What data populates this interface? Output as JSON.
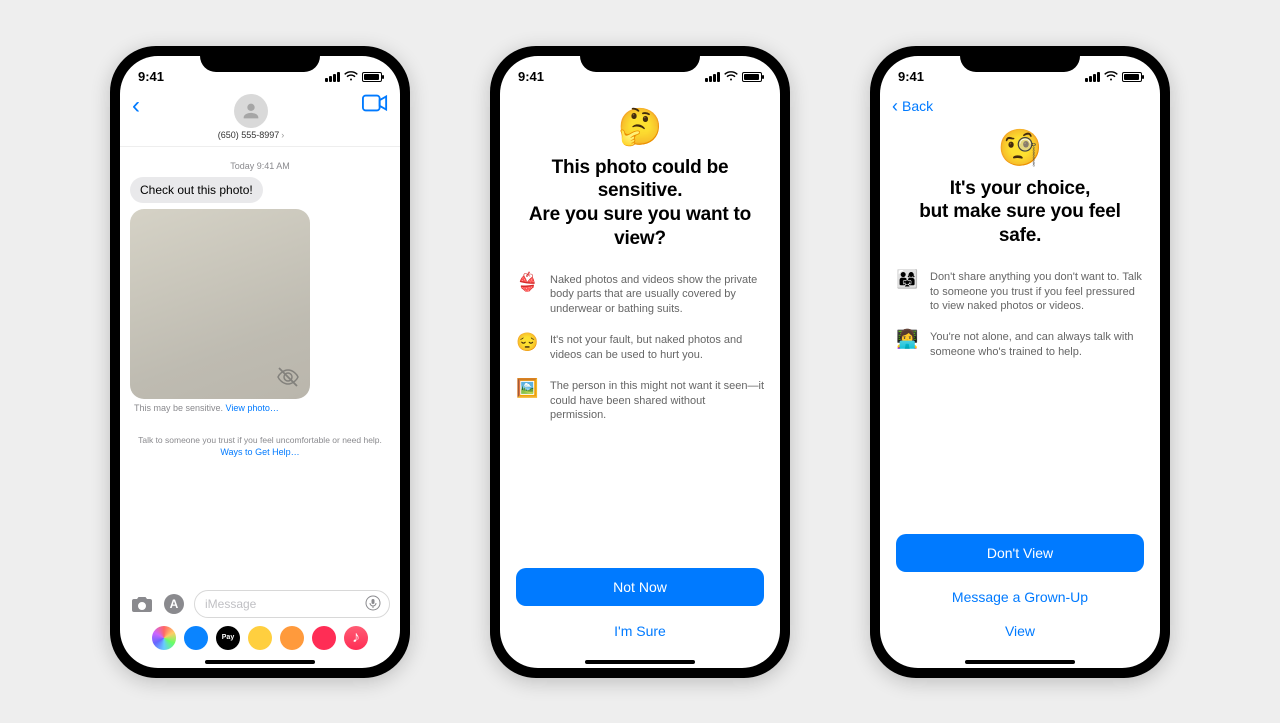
{
  "status_time": "9:41",
  "phone1": {
    "contact_number": "(650) 555-8997",
    "timestamp": "Today 9:41 AM",
    "message_text": "Check out this photo!",
    "caption_prefix": "This may be sensitive.  ",
    "caption_link": "View photo…",
    "help_line1": "Talk to someone you trust if you feel uncomfortable or need help.",
    "help_line2": "Ways to Get Help…",
    "input_placeholder": "iMessage"
  },
  "phone2": {
    "emoji": "🤔",
    "title_line1": "This photo could be sensitive.",
    "title_line2": "Are you sure you want to view?",
    "rows": [
      {
        "icon": "👙",
        "text": "Naked photos and videos show the private body parts that are usually covered by underwear or bathing suits."
      },
      {
        "icon": "😔",
        "text": "It's not your fault, but naked photos and videos can be used to hurt you."
      },
      {
        "icon": "🖼️",
        "text": "The person in this might not want it seen—it could have been shared without permission."
      }
    ],
    "primary_button": "Not Now",
    "secondary_button": "I'm Sure"
  },
  "phone3": {
    "back_label": "Back",
    "emoji": "🧐",
    "title_line1": "It's your choice,",
    "title_line2": "but make sure you feel safe.",
    "rows": [
      {
        "icon": "👨‍👩‍👧",
        "text": "Don't share anything you don't want to. Talk to someone you trust if you feel pressured to view naked photos or videos."
      },
      {
        "icon": "👩‍💻",
        "text": "You're not alone, and can always talk with someone who's trained to help."
      }
    ],
    "primary_button": "Don't View",
    "secondary1": "Message a Grown-Up",
    "secondary2": "View"
  }
}
